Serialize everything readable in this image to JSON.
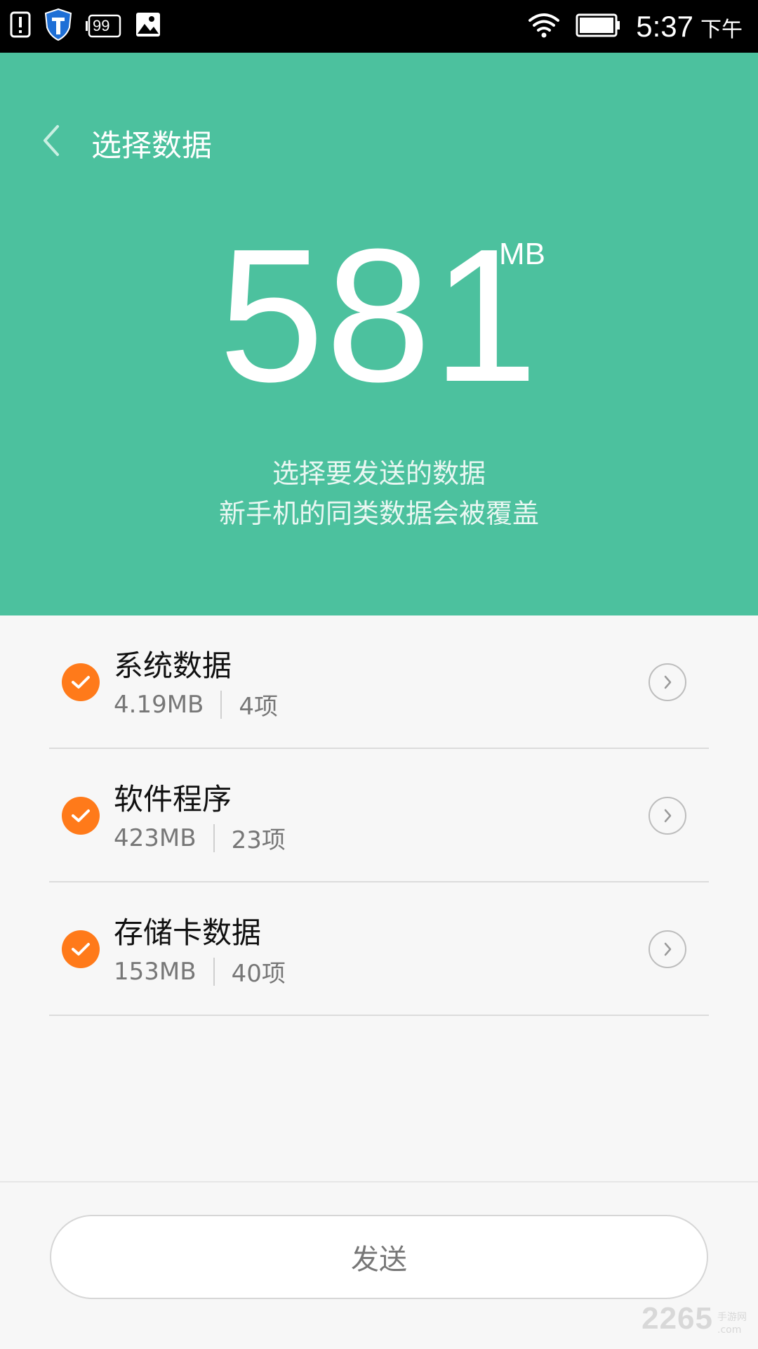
{
  "status_bar": {
    "time": "5:37",
    "ampm": "下午",
    "battery_badge": "99",
    "icons": [
      "alert-icon",
      "shield-icon",
      "notification-count-icon",
      "image-icon",
      "wifi-icon",
      "battery-icon"
    ]
  },
  "header": {
    "title": "选择数据",
    "size_value": "581",
    "size_unit": "MB",
    "subtitle_line1": "选择要发送的数据",
    "subtitle_line2": "新手机的同类数据会被覆盖",
    "background_color": "#4cc19e"
  },
  "items": [
    {
      "title": "系统数据",
      "size": "4.19MB",
      "count": "4项",
      "checked": true
    },
    {
      "title": "软件程序",
      "size": "423MB",
      "count": "23项",
      "checked": true
    },
    {
      "title": "存储卡数据",
      "size": "153MB",
      "count": "40项",
      "checked": true
    }
  ],
  "footer": {
    "send_label": "发送"
  },
  "watermark": {
    "main": "2265",
    "suffix": ".com",
    "cn": "手游网"
  },
  "colors": {
    "accent_green": "#4cc19e",
    "check_orange": "#ff7a1a"
  }
}
